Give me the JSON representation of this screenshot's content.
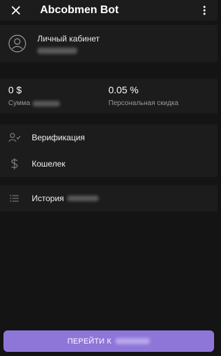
{
  "header": {
    "title": "Abcobmen Bot"
  },
  "profile": {
    "name": "Личный кабинет"
  },
  "stats": [
    {
      "value": "0 $",
      "label": "Сумма"
    },
    {
      "value": "0.05 %",
      "label": "Персональная скидка"
    }
  ],
  "menu_primary": [
    {
      "label": "Верификация",
      "icon": "user-check-icon"
    },
    {
      "label": "Кошелек",
      "icon": "dollar-icon"
    }
  ],
  "menu_secondary": [
    {
      "label": "История",
      "icon": "list-icon"
    }
  ],
  "footer": {
    "button_label": "ПЕРЕЙТИ К"
  },
  "colors": {
    "accent": "#8e76d8",
    "background": "#141414",
    "surface": "#1c1c1c"
  }
}
